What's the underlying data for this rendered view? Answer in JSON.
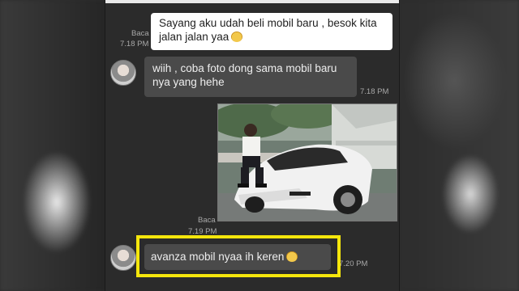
{
  "messages": {
    "m1": {
      "text": "Sayang aku udah beli mobil baru , besok kita jalan jalan yaa",
      "status": "Baca",
      "time": "7.18 PM"
    },
    "m2": {
      "text": "wiih , coba foto dong sama mobil baru nya yang hehe",
      "time": "7.18 PM"
    },
    "m3": {
      "status": "Baca",
      "time": "7.19 PM"
    },
    "m4": {
      "text": "avanza mobil nyaa ih keren",
      "time": "7.20 PM"
    }
  },
  "icons": {
    "emoji": "grinning-emoji-icon",
    "avatar": "contact-avatar"
  },
  "colors": {
    "highlight": "#f5e60c",
    "outgoing_bubble": "#ffffff",
    "incoming_bubble": "#4a4a4a",
    "chat_bg": "#2b2b2b"
  }
}
